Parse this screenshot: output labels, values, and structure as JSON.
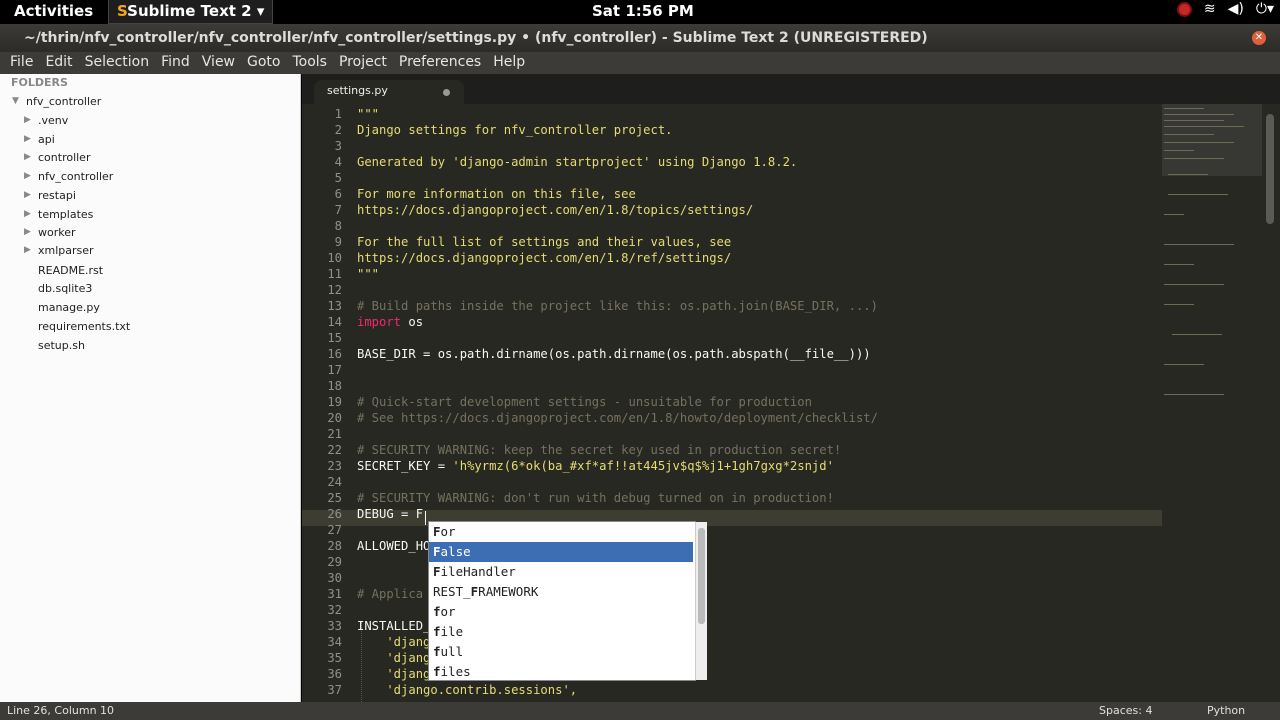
{
  "topbar": {
    "activities": "Activities",
    "app_menu": "Sublime Text 2",
    "clock": "Sat  1:56 PM"
  },
  "window": {
    "title": "~/thrin/nfv_controller/nfv_controller/nfv_controller/settings.py • (nfv_controller) - Sublime Text 2 (UNREGISTERED)"
  },
  "menu": [
    "File",
    "Edit",
    "Selection",
    "Find",
    "View",
    "Goto",
    "Tools",
    "Project",
    "Preferences",
    "Help"
  ],
  "sidebar": {
    "header": "FOLDERS",
    "root": "nfv_controller",
    "folders": [
      ".venv",
      "api",
      "controller",
      "nfv_controller",
      "restapi",
      "templates",
      "worker",
      "xmlparser"
    ],
    "files": [
      "README.rst",
      "db.sqlite3",
      "manage.py",
      "requirements.txt",
      "setup.sh"
    ]
  },
  "tab": {
    "label": "settings.py"
  },
  "code": {
    "line_numbers": [
      "1",
      "2",
      "3",
      "4",
      "5",
      "6",
      "7",
      "8",
      "9",
      "10",
      "11",
      "12",
      "13",
      "14",
      "15",
      "16",
      "17",
      "18",
      "19",
      "20",
      "21",
      "22",
      "23",
      "24",
      "25",
      "26",
      "27",
      "28",
      "29",
      "30",
      "31",
      "32",
      "33",
      "34",
      "35",
      "36",
      "37"
    ],
    "lines": [
      "\"\"\"",
      "Django settings for nfv_controller project.",
      "",
      "Generated by 'django-admin startproject' using Django 1.8.2.",
      "",
      "For more information on this file, see",
      "https://docs.djangoproject.com/en/1.8/topics/settings/",
      "",
      "For the full list of settings and their values, see",
      "https://docs.djangoproject.com/en/1.8/ref/settings/",
      "\"\"\"",
      "",
      "# Build paths inside the project like this: os.path.join(BASE_DIR, ...)",
      "os",
      "",
      "BASE_DIR = os.path.dirname(os.path.dirname(os.path.abspath(__file__)))",
      "",
      "",
      "# Quick-start development settings - unsuitable for production",
      "# See https://docs.djangoproject.com/en/1.8/howto/deployment/checklist/",
      "",
      "# SECURITY WARNING: keep the secret key used in production secret!",
      "SECRET_KEY = ",
      "",
      "# SECURITY WARNING: don't run with debug turned on in production!",
      "DEBUG = F",
      "",
      "ALLOWED_HO",
      "",
      "",
      "# Applica",
      "",
      "INSTALLED_",
      "    'djang",
      "    'djang",
      "    'djang",
      "    'django.contrib.sessions',"
    ],
    "import_kw": "import",
    "secret_value": "'h%yrmz(6*ok(ba_#xf*af!!at445jv$q$%j1+1gh7gxg*2snjd'"
  },
  "autocomplete": {
    "selected_index": 1,
    "items": [
      {
        "bold": "F",
        "rest": "or"
      },
      {
        "bold": "F",
        "rest": "alse"
      },
      {
        "bold": "F",
        "rest": "ileHandler"
      },
      {
        "pre": "REST_",
        "bold": "F",
        "rest": "RAMEWORK"
      },
      {
        "bold": "f",
        "rest": "or"
      },
      {
        "bold": "f",
        "rest": "ile"
      },
      {
        "bold": "f",
        "rest": "ull"
      },
      {
        "bold": "f",
        "rest": "iles"
      }
    ]
  },
  "status": {
    "position": "Line 26, Column 10",
    "spaces": "Spaces: 4",
    "syntax": "Python"
  }
}
